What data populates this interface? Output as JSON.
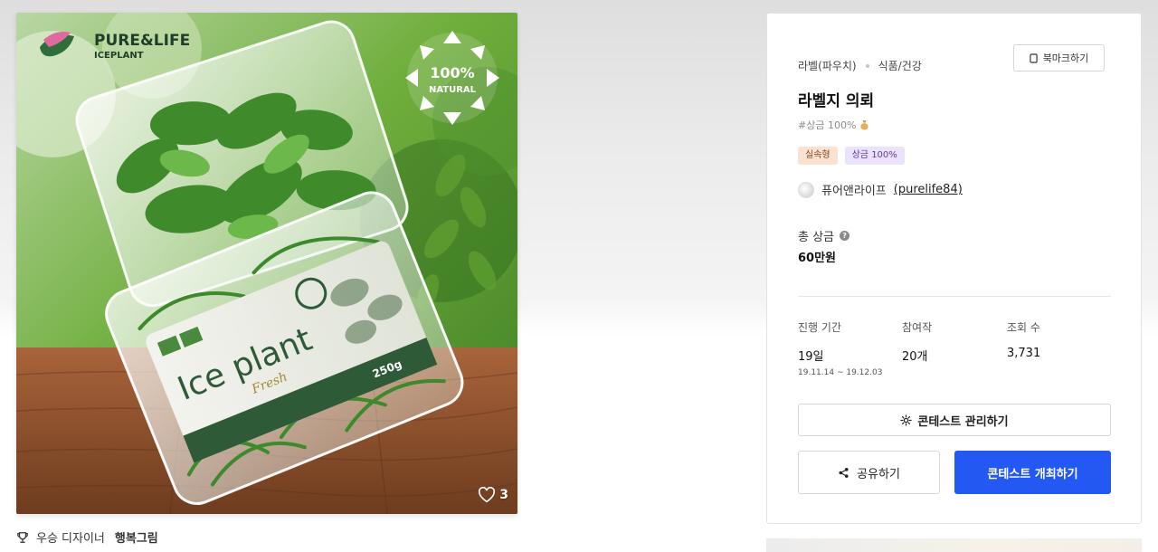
{
  "artwork": {
    "brand_name": "PURE&LIFE",
    "brand_sub": "ICEPLANT",
    "seal_top": "100%",
    "seal_bottom": "NATURAL",
    "package_title": "Ice plant",
    "package_script": "Fresh",
    "package_weight": "250g",
    "likes": "3"
  },
  "winner": {
    "label": "우승 디자이너",
    "name": "행복그림"
  },
  "contest": {
    "breadcrumb": [
      "라벨(파우치)",
      "식품/건강"
    ],
    "bookmark_label": "북마크하기",
    "title": "라벨지 의뢰",
    "hashtag": "#상금 100%",
    "badges": [
      "실속형",
      "상금 100%"
    ],
    "host_name": "퓨어앤라이프",
    "host_handle": "(purelife84)",
    "prize_label": "총 상금",
    "prize_value": "60만원",
    "stats": {
      "duration_label": "진행 기간",
      "duration_value": "19일",
      "duration_range": "19.11.14 ~ 19.12.03",
      "participants_label": "참여작",
      "participants_value": "20개",
      "views_label": "조회 수",
      "views_value": "3,731"
    },
    "manage_label": "콘테스트 관리하기",
    "share_label": "공유하기",
    "host_contest_label": "콘테스트 개최하기"
  },
  "colors": {
    "primary_button": "#2458f3",
    "badge_orange": "#fbe1d0",
    "badge_purple": "#ebe2fb"
  }
}
